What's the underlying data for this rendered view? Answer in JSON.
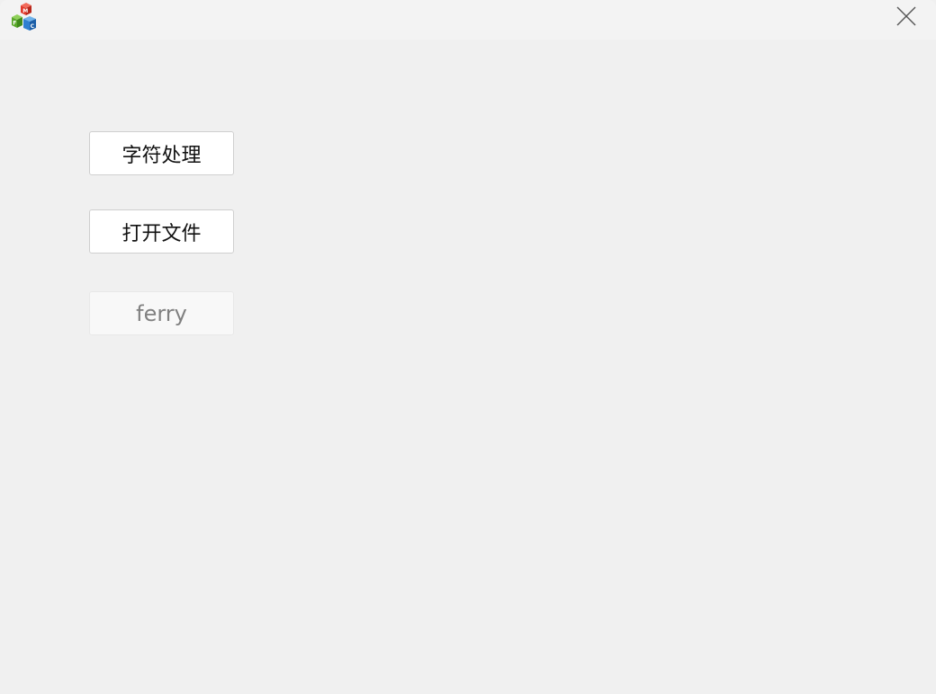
{
  "window": {
    "app_icon": "mfc-cubes-icon",
    "close_icon": "close-icon"
  },
  "main": {
    "char_button_label": "字符处理",
    "open_file_button_label": "打开文件",
    "ferry_button_label": "ferry"
  },
  "colors": {
    "window_bg": "#f0f0f0",
    "titlebar_bg": "#f3f3f3",
    "button_bg": "#ffffff",
    "disabled_text": "#808080"
  }
}
